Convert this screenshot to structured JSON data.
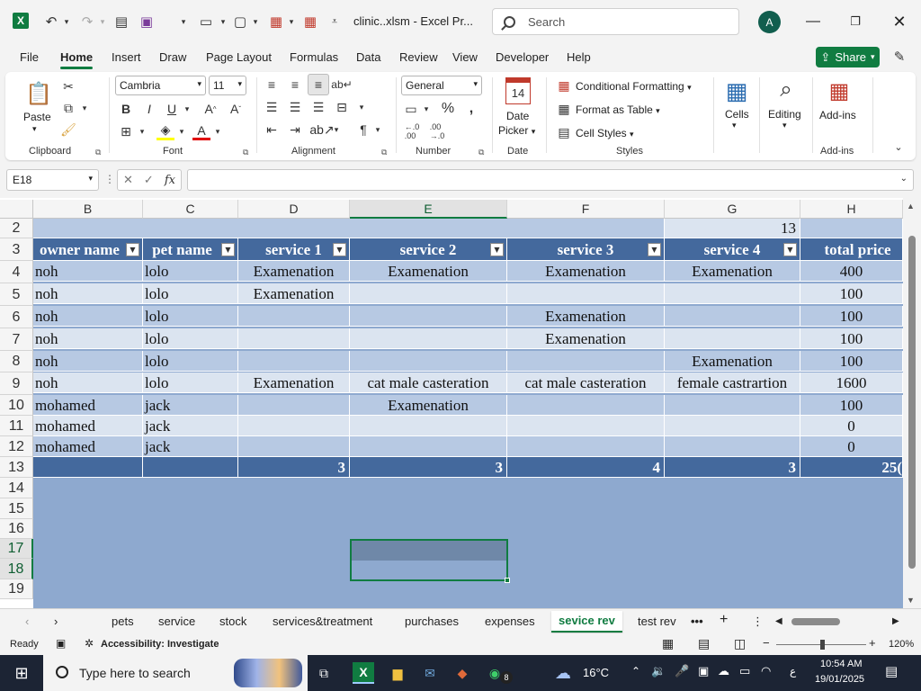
{
  "titlebar": {
    "filename": "clinic..xlsm",
    "app": "Excel Pr...",
    "search_placeholder": "Search",
    "avatar": "A"
  },
  "menu": [
    "File",
    "Home",
    "Insert",
    "Draw",
    "Page Layout",
    "Formulas",
    "Data",
    "Review",
    "View",
    "Developer",
    "Help"
  ],
  "share_label": "Share",
  "ribbon": {
    "clipboard": {
      "paste": "Paste",
      "label": "Clipboard"
    },
    "font": {
      "name": "Cambria",
      "size": "11",
      "label": "Font"
    },
    "alignment": {
      "label": "Alignment"
    },
    "number": {
      "format": "General",
      "label": "Number"
    },
    "date": {
      "line1": "Date",
      "line2": "Picker",
      "label": "Date"
    },
    "styles": {
      "cond": "Conditional Formatting",
      "table": "Format as Table",
      "cell": "Cell Styles",
      "label": "Styles"
    },
    "cells": {
      "label": "Cells"
    },
    "editing": {
      "label": "Editing"
    },
    "addins": {
      "button": "Add-ins",
      "label": "Add-ins"
    }
  },
  "namebox": "E18",
  "columns": [
    "B",
    "C",
    "D",
    "E",
    "F",
    "G",
    "H"
  ],
  "rows": [
    "2",
    "3",
    "4",
    "5",
    "6",
    "7",
    "8",
    "9",
    "10",
    "11",
    "12",
    "13",
    "14",
    "15",
    "16",
    "17",
    "18",
    "19"
  ],
  "cell_g2": "13",
  "headers": [
    "owner name",
    "pet name",
    "service 1",
    "service 2",
    "service 3",
    "service 4",
    "total price"
  ],
  "data_rows": [
    [
      "noh",
      "lolo",
      "Examenation",
      "Examenation",
      "Examenation",
      "Examenation",
      "400"
    ],
    [
      "noh",
      "lolo",
      "Examenation",
      "",
      "",
      "",
      "100"
    ],
    [
      "noh",
      "lolo",
      "",
      "",
      "Examenation",
      "",
      "100"
    ],
    [
      "noh",
      "lolo",
      "",
      "",
      "Examenation",
      "",
      "100"
    ],
    [
      "noh",
      "lolo",
      "",
      "",
      "",
      "Examenation",
      "100"
    ],
    [
      "noh",
      "lolo",
      "Examenation",
      "cat male casteration",
      "cat male casteration",
      "female castrartion",
      "1600"
    ],
    [
      "mohamed",
      "jack",
      "",
      "Examenation",
      "",
      "",
      "100"
    ],
    [
      "mohamed",
      "jack",
      "",
      "",
      "",
      "",
      "0"
    ],
    [
      "mohamed",
      "jack",
      "",
      "",
      "",
      "",
      "0"
    ]
  ],
  "totals": [
    "",
    "",
    "3",
    "3",
    "4",
    "3",
    "25("
  ],
  "sheets": [
    "pets",
    "service",
    "stock",
    "services&treatment",
    "purchases",
    "expenses",
    "sevice rev",
    "test rev"
  ],
  "status": {
    "ready": "Ready",
    "accessibility": "Accessibility: Investigate",
    "zoom": "120%"
  },
  "taskbar": {
    "search": "Type here to search",
    "temp": "16°C",
    "time": "10:54 AM",
    "date": "19/01/2025",
    "lang": "ع",
    "badge": "8"
  },
  "colors": {
    "accent": "#107c41",
    "header_blue": "#44699d",
    "band_dark": "#b7c9e3",
    "band_light": "#dbe4f0"
  }
}
